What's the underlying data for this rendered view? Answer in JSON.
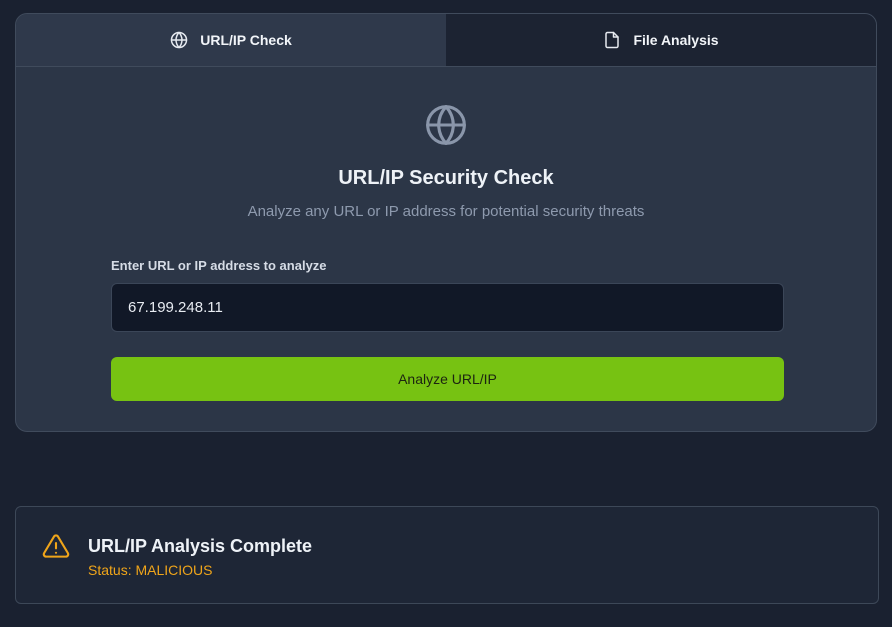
{
  "tabs": [
    {
      "label": "URL/IP Check",
      "icon": "globe-icon",
      "active": true
    },
    {
      "label": "File Analysis",
      "icon": "file-icon",
      "active": false
    }
  ],
  "hero": {
    "icon": "globe-icon",
    "title": "URL/IP Security Check",
    "subtitle": "Analyze any URL or IP address for potential security threats"
  },
  "form": {
    "label": "Enter URL or IP address to analyze",
    "value": "67.199.248.11",
    "button_label": "Analyze URL/IP"
  },
  "result": {
    "icon": "warning-icon",
    "title": "URL/IP Analysis Complete",
    "status_label": "Status:",
    "status_value": "MALICIOUS"
  },
  "colors": {
    "background": "#1a2130",
    "card": "#2c3647",
    "accent_button": "#77c212",
    "warning": "#f0a51a"
  }
}
